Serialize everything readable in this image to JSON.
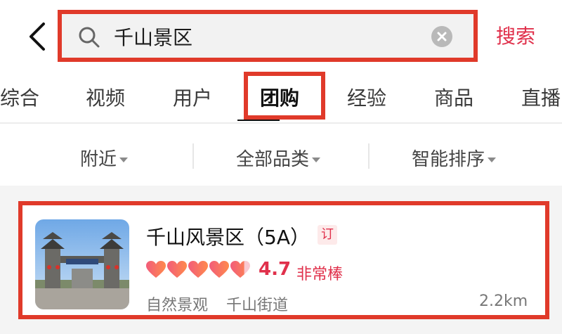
{
  "search": {
    "query": "千山景区",
    "submit_label": "搜索"
  },
  "tabs": [
    {
      "label": "综合"
    },
    {
      "label": "视频"
    },
    {
      "label": "用户"
    },
    {
      "label": "团购",
      "active": true
    },
    {
      "label": "经验"
    },
    {
      "label": "商品"
    },
    {
      "label": "直播"
    }
  ],
  "filters": [
    {
      "label": "附近"
    },
    {
      "label": "全部品类"
    },
    {
      "label": "智能排序"
    }
  ],
  "result": {
    "title": "千山风景区（5A）",
    "badge": "订",
    "rating_hearts": 4.7,
    "rating_score": "4.7",
    "rating_desc": "非常棒",
    "category": "自然景观",
    "area": "千山街道",
    "distance": "2.2km"
  },
  "colors": {
    "accent": "#e0304b",
    "highlight_border": "#e03a2a",
    "heart_pink": "#f25c7a",
    "heart_orange": "#ff8a4c"
  },
  "icons": [
    "back-icon",
    "search-icon",
    "clear-icon",
    "caret-down-icon",
    "heart-icon"
  ]
}
